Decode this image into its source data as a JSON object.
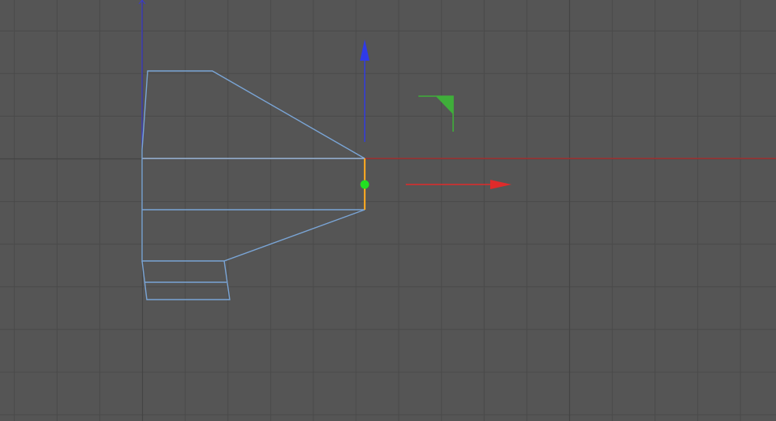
{
  "viewport": {
    "view": "orthographic-side",
    "grid": true
  },
  "colors": {
    "background": "#555555",
    "grid_minor": "#4a4a4a",
    "grid_major": "#444444",
    "world_axis_x": "#b52a2a",
    "world_axis_y": "#3b3bd0",
    "mesh_wire": "#7aa5d6",
    "mesh_wire_light": "#9bb8dc",
    "selected_edge": "#f5a623",
    "gizmo_x": "#e02b2b",
    "gizmo_y": "#2f3ae8",
    "gizmo_plane": "#3fae3a",
    "gizmo_center": "#21e021"
  },
  "selection": {
    "mode": "edge",
    "selected_count": 1
  },
  "gizmo": {
    "type": "move",
    "handles": [
      "x-arrow",
      "y-arrow",
      "xy-plane"
    ]
  }
}
